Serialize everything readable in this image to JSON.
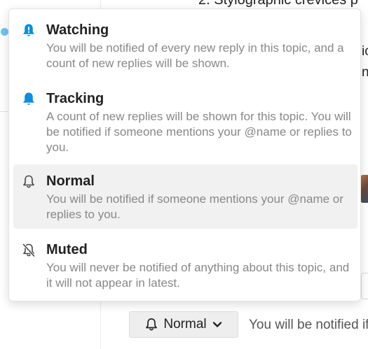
{
  "background": {
    "heading": "2. Stylographic crevices p",
    "fragments": [
      "ic",
      "n"
    ]
  },
  "colors": {
    "accent": "#0c8de0",
    "bell_dark": "#444444",
    "dot": "#6fc3ee",
    "selected_bg": "#f1f1f1",
    "description": "#888888"
  },
  "menu": {
    "options": [
      {
        "title": "Watching",
        "icon": "bell-exclamation-icon",
        "description": "You will be notified of every new reply in this topic, and a count of new replies will be shown."
      },
      {
        "title": "Tracking",
        "icon": "bell-filled-icon",
        "description": "A count of new replies will be shown for this topic. You will be notified if someone mentions your @name or replies to you."
      },
      {
        "title": "Normal",
        "icon": "bell-outline-icon",
        "selected": true,
        "description": "You will be notified if someone mentions your @name or replies to you."
      },
      {
        "title": "Muted",
        "icon": "bell-slash-icon",
        "description": "You will never be notified of anything about this topic, and it will not appear in latest."
      }
    ]
  },
  "footer": {
    "button_label": "Normal",
    "button_icon": "bell-outline-icon",
    "reason": "You will be notified if"
  }
}
